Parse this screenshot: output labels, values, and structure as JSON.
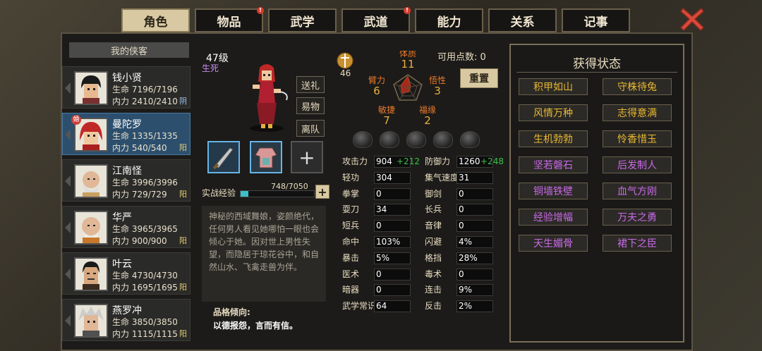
{
  "tabs": [
    {
      "label": "角色",
      "active": true,
      "alert": false
    },
    {
      "label": "物品",
      "active": false,
      "alert": true
    },
    {
      "label": "武学",
      "active": false,
      "alert": false
    },
    {
      "label": "武道",
      "active": false,
      "alert": true
    },
    {
      "label": "能力",
      "active": false,
      "alert": false
    },
    {
      "label": "关系",
      "active": false,
      "alert": false
    },
    {
      "label": "记事",
      "active": false,
      "alert": false
    }
  ],
  "roster": {
    "title": "我的侠客",
    "heroes": [
      {
        "name": "钱小贤",
        "hp": "生命 7196/7196",
        "mp": "内力 2410/2410",
        "tag": "阴"
      },
      {
        "name": "曼陀罗",
        "hp": "生命 1335/1335",
        "mp": "内力 540/540",
        "tag": "阳",
        "badge": "婚"
      },
      {
        "name": "江南怪",
        "hp": "生命 3996/3996",
        "mp": "内力 729/729",
        "tag": "阳"
      },
      {
        "name": "华严",
        "hp": "生命 3965/3965",
        "mp": "内力 900/900",
        "tag": "阳"
      },
      {
        "name": "叶云",
        "hp": "生命 4730/4730",
        "mp": "内力 1695/1695",
        "tag": "阳"
      },
      {
        "name": "燕罗冲",
        "hp": "生命 3850/3850",
        "mp": "内力 1115/1115",
        "tag": "阳"
      }
    ]
  },
  "character": {
    "level": "47级",
    "state": "生死",
    "buttons": [
      "送礼",
      "易物",
      "离队"
    ],
    "exp_label": "实战经验",
    "exp_value": "748/7050",
    "exp_progress": 0.106,
    "description": "神秘的西域舞娘，姿颜绝代，任何男人看见她哪怕一眼也会倾心于她。因对世上男性失望，而隐居于琼花谷中，和自然山水、飞禽走兽为伴。",
    "trait_title": "品格倾向:",
    "trait": "以德报怨，言而有信。"
  },
  "attributes": {
    "rank": "46",
    "points_label": "可用点数: 0",
    "reset_label": "重置",
    "radar": [
      {
        "name": "体质",
        "value": "11"
      },
      {
        "name": "悟性",
        "value": "3"
      },
      {
        "name": "福缘",
        "value": "2"
      },
      {
        "name": "敏捷",
        "value": "7"
      },
      {
        "name": "臂力",
        "value": "6"
      }
    ]
  },
  "stats": {
    "left": [
      {
        "label": "攻击力",
        "value": "904",
        "bonus": "+212"
      },
      {
        "label": "轻功",
        "value": "304",
        "bonus": ""
      },
      {
        "label": "拳掌",
        "value": "0",
        "bonus": ""
      },
      {
        "label": "耍刀",
        "value": "34",
        "bonus": ""
      },
      {
        "label": "短兵",
        "value": "0",
        "bonus": ""
      },
      {
        "label": "命中",
        "value": "103%",
        "bonus": ""
      },
      {
        "label": "暴击",
        "value": "5%",
        "bonus": ""
      },
      {
        "label": "医术",
        "value": "0",
        "bonus": ""
      },
      {
        "label": "暗器",
        "value": "0",
        "bonus": ""
      },
      {
        "label": "武学常识",
        "value": "64",
        "bonus": ""
      }
    ],
    "right": [
      {
        "label": "防御力",
        "value": "1260",
        "bonus": "+248"
      },
      {
        "label": "集气速度",
        "value": "31",
        "bonus": ""
      },
      {
        "label": "御剑",
        "value": "0",
        "bonus": ""
      },
      {
        "label": "长兵",
        "value": "0",
        "bonus": ""
      },
      {
        "label": "音律",
        "value": "0",
        "bonus": ""
      },
      {
        "label": "闪避",
        "value": "4%",
        "bonus": ""
      },
      {
        "label": "格挡",
        "value": "28%",
        "bonus": ""
      },
      {
        "label": "毒术",
        "value": "0",
        "bonus": ""
      },
      {
        "label": "连击",
        "value": "9%",
        "bonus": ""
      },
      {
        "label": "反击",
        "value": "2%",
        "bonus": ""
      }
    ]
  },
  "status_panel": {
    "title": "获得状态",
    "items": [
      {
        "label": "积甲如山",
        "color": "#e8b832"
      },
      {
        "label": "守株待兔",
        "color": "#e8b832"
      },
      {
        "label": "风情万种",
        "color": "#e8b832"
      },
      {
        "label": "志得意满",
        "color": "#e8b832"
      },
      {
        "label": "生机勃勃",
        "color": "#e8b832"
      },
      {
        "label": "怜香惜玉",
        "color": "#e8b832"
      },
      {
        "label": "坚若磐石",
        "color": "#c96ae8"
      },
      {
        "label": "后发制人",
        "color": "#c96ae8"
      },
      {
        "label": "铜墙铁壁",
        "color": "#c96ae8"
      },
      {
        "label": "血气方刚",
        "color": "#c96ae8"
      },
      {
        "label": "经验增幅",
        "color": "#c96ae8"
      },
      {
        "label": "万夫之勇",
        "color": "#c96ae8"
      },
      {
        "label": "天生媚骨",
        "color": "#c96ae8"
      },
      {
        "label": "裙下之臣",
        "color": "#c96ae8"
      }
    ]
  }
}
